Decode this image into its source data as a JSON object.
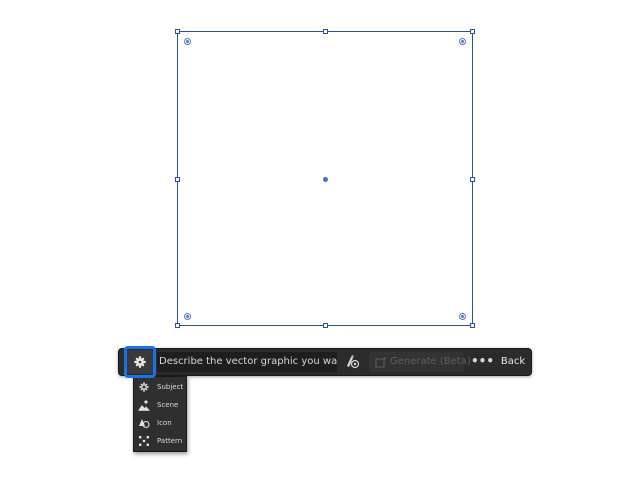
{
  "canvas": {
    "selection_color": "#2b4ea6",
    "widget_color": "#5577d4"
  },
  "taskbar": {
    "type_button_icon": "subject-icon",
    "prompt_placeholder": "Describe the vector graphic you want to",
    "style_button_icon": "style-picker-icon",
    "generate_label": "Generate (Beta)",
    "generate_icon": "generate-icon",
    "more_label": "•••",
    "back_label": "Back",
    "highlight_color": "#1473e6"
  },
  "type_menu": {
    "items": [
      {
        "label": "Subject",
        "icon": "subject-icon"
      },
      {
        "label": "Scene",
        "icon": "scene-icon"
      },
      {
        "label": "Icon",
        "icon": "icon-type-icon"
      },
      {
        "label": "Pattern",
        "icon": "pattern-icon"
      }
    ]
  }
}
